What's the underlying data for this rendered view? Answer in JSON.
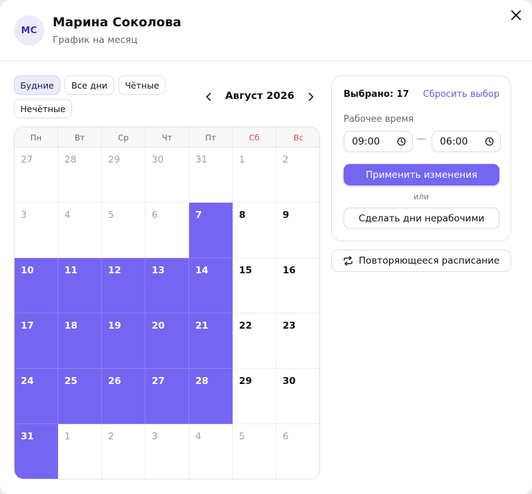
{
  "header": {
    "avatar_initials": "МС",
    "name": "Марина Соколова",
    "subtitle": "График на месяц"
  },
  "filters": [
    {
      "label": "Будние",
      "active": true
    },
    {
      "label": "Все дни",
      "active": false
    },
    {
      "label": "Чётные",
      "active": false
    },
    {
      "label": "Нечётные",
      "active": false
    }
  ],
  "month": {
    "label": "Август 2026",
    "weekdays": [
      "Пн",
      "Вт",
      "Ср",
      "Чт",
      "Пт",
      "Сб",
      "Вс"
    ],
    "weekend_color": "#e04848"
  },
  "calendar": {
    "weeks": [
      [
        {
          "d": "27",
          "s": "muted"
        },
        {
          "d": "28",
          "s": "muted"
        },
        {
          "d": "29",
          "s": "muted"
        },
        {
          "d": "30",
          "s": "muted"
        },
        {
          "d": "31",
          "s": "muted"
        },
        {
          "d": "1",
          "s": "muted"
        },
        {
          "d": "2",
          "s": "muted"
        }
      ],
      [
        {
          "d": "3",
          "s": "muted"
        },
        {
          "d": "4",
          "s": "muted"
        },
        {
          "d": "5",
          "s": "muted"
        },
        {
          "d": "6",
          "s": "muted"
        },
        {
          "d": "7",
          "s": "selected"
        },
        {
          "d": "8",
          "s": "normal"
        },
        {
          "d": "9",
          "s": "normal"
        }
      ],
      [
        {
          "d": "10",
          "s": "selected"
        },
        {
          "d": "11",
          "s": "selected"
        },
        {
          "d": "12",
          "s": "selected"
        },
        {
          "d": "13",
          "s": "selected"
        },
        {
          "d": "14",
          "s": "selected"
        },
        {
          "d": "15",
          "s": "normal"
        },
        {
          "d": "16",
          "s": "normal"
        }
      ],
      [
        {
          "d": "17",
          "s": "selected"
        },
        {
          "d": "18",
          "s": "selected"
        },
        {
          "d": "19",
          "s": "selected"
        },
        {
          "d": "20",
          "s": "selected"
        },
        {
          "d": "21",
          "s": "selected"
        },
        {
          "d": "22",
          "s": "normal"
        },
        {
          "d": "23",
          "s": "normal"
        }
      ],
      [
        {
          "d": "24",
          "s": "selected"
        },
        {
          "d": "25",
          "s": "selected"
        },
        {
          "d": "26",
          "s": "selected"
        },
        {
          "d": "27",
          "s": "selected"
        },
        {
          "d": "28",
          "s": "selected"
        },
        {
          "d": "29",
          "s": "normal"
        },
        {
          "d": "30",
          "s": "normal"
        }
      ],
      [
        {
          "d": "31",
          "s": "selected"
        },
        {
          "d": "1",
          "s": "muted"
        },
        {
          "d": "2",
          "s": "muted"
        },
        {
          "d": "3",
          "s": "muted"
        },
        {
          "d": "4",
          "s": "muted"
        },
        {
          "d": "5",
          "s": "muted"
        },
        {
          "d": "6",
          "s": "muted"
        }
      ]
    ],
    "selected_color": "#7566f2"
  },
  "panel": {
    "selected_label": "Выбрано: 17",
    "reset_label": "Сбросить выбор",
    "work_time_label": "Рабочее время",
    "time_from": "09:00",
    "time_separator": "—",
    "time_to": "06:00",
    "apply_label": "Применить изменения",
    "or_label": "или",
    "nonworking_label": "Сделать дни нерабочими"
  },
  "repeat_label": "Повторяющееся расписание",
  "accent_color": "#7566f2"
}
